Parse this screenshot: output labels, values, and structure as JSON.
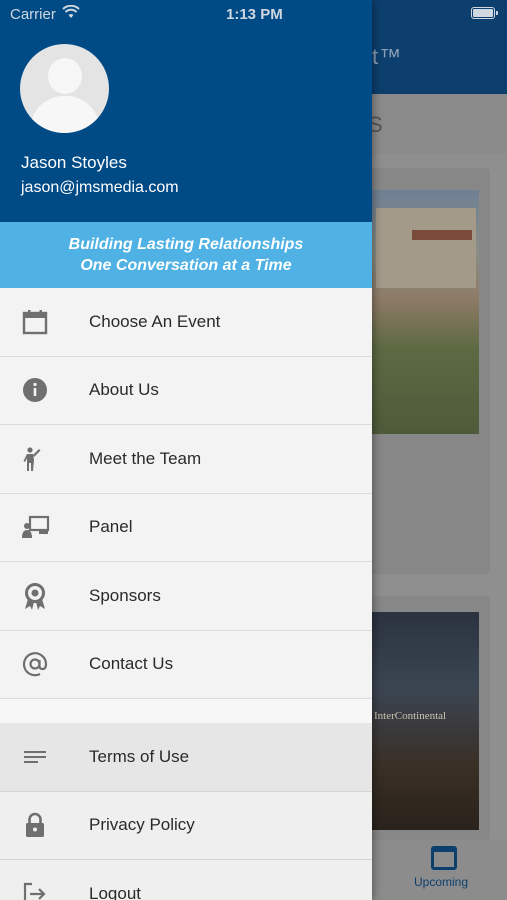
{
  "status_bar": {
    "carrier": "Carrier",
    "time": "1:13 PM",
    "battery_level": 1.0
  },
  "background": {
    "header_title": "t™",
    "section_title": "S",
    "card2_text": "InterContinental",
    "tab_label": "Upcoming",
    "tab_icon": "calendar-icon"
  },
  "profile": {
    "name": "Jason Stoyles",
    "email": "jason@jmsmedia.com",
    "avatar_icon": "person-icon"
  },
  "tagline": {
    "line1": "Building Lasting Relationships",
    "line2": "One Conversation at a Time"
  },
  "menu": [
    {
      "label": "Choose An Event",
      "icon": "calendar-icon"
    },
    {
      "label": "About Us",
      "icon": "info-icon"
    },
    {
      "label": "Meet the Team",
      "icon": "person-waving-icon"
    },
    {
      "label": "Panel",
      "icon": "presentation-icon"
    },
    {
      "label": "Sponsors",
      "icon": "award-ribbon-icon"
    },
    {
      "label": "Contact Us",
      "icon": "at-sign-icon"
    }
  ],
  "secondary_menu": [
    {
      "label": "Terms of Use",
      "icon": "lines-icon"
    },
    {
      "label": "Privacy Policy",
      "icon": "lock-icon"
    },
    {
      "label": "Logout",
      "icon": "logout-icon"
    }
  ],
  "colors": {
    "header_blue": "#004a86",
    "tagline_blue": "#4fb1e4",
    "icon_gray": "#6f6f6f"
  }
}
